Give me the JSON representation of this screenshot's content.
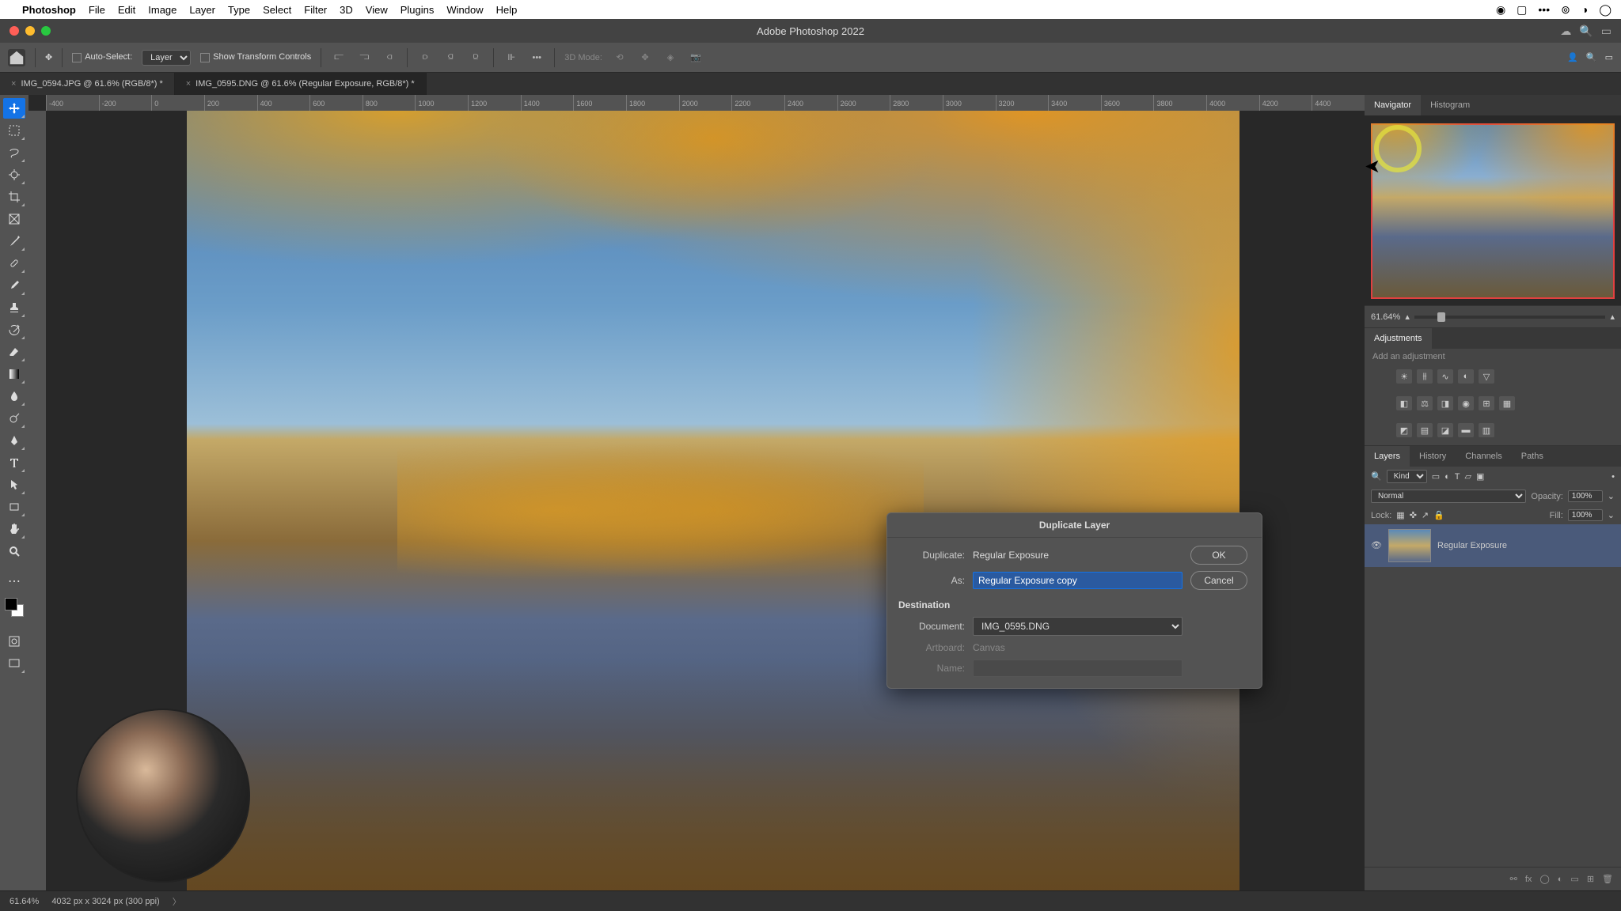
{
  "menu": {
    "app": "Photoshop",
    "items": [
      "File",
      "Edit",
      "Image",
      "Layer",
      "Type",
      "Select",
      "Filter",
      "3D",
      "View",
      "Plugins",
      "Window",
      "Help"
    ]
  },
  "titlebar": {
    "title": "Adobe Photoshop 2022"
  },
  "options": {
    "auto_select": "Auto-Select:",
    "layer_dd": "Layer",
    "show_transform": "Show Transform Controls",
    "mode3d": "3D Mode:"
  },
  "tabs": [
    {
      "label": "IMG_0594.JPG @ 61.6% (RGB/8*) *",
      "active": false
    },
    {
      "label": "IMG_0595.DNG @ 61.6% (Regular Exposure, RGB/8*) *",
      "active": true
    }
  ],
  "ruler": [
    "-400",
    "-200",
    "0",
    "200",
    "400",
    "600",
    "800",
    "1000",
    "1200",
    "1400",
    "1600",
    "1800",
    "2000",
    "2200",
    "2400",
    "2600",
    "2800",
    "3000",
    "3200",
    "3400",
    "3600",
    "3800",
    "4000",
    "4200",
    "4400"
  ],
  "navigator": {
    "tab1": "Navigator",
    "tab2": "Histogram",
    "zoom": "61.64%"
  },
  "adjustments": {
    "title": "Adjustments",
    "sub": "Add an adjustment"
  },
  "layers": {
    "tabs": [
      "Layers",
      "History",
      "Channels",
      "Paths"
    ],
    "kind": "Kind",
    "blend": "Normal",
    "opacity_lbl": "Opacity:",
    "opacity": "100%",
    "lock_lbl": "Lock:",
    "fill_lbl": "Fill:",
    "fill": "100%",
    "layer_name": "Regular Exposure"
  },
  "dialog": {
    "title": "Duplicate Layer",
    "dup_lbl": "Duplicate:",
    "dup_val": "Regular Exposure",
    "as_lbl": "As:",
    "as_val": "Regular Exposure copy",
    "dest_lbl": "Destination",
    "doc_lbl": "Document:",
    "doc_val": "IMG_0595.DNG",
    "art_lbl": "Artboard:",
    "art_val": "Canvas",
    "name_lbl": "Name:",
    "name_val": "",
    "ok": "OK",
    "cancel": "Cancel"
  },
  "status": {
    "zoom": "61.64%",
    "dims": "4032 px x 3024 px (300 ppi)"
  }
}
